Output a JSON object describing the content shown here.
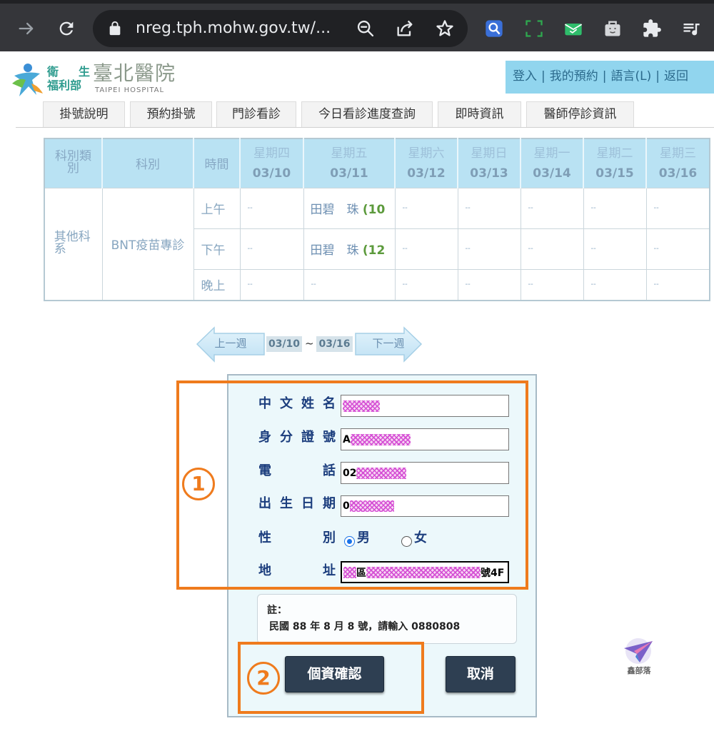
{
  "browser": {
    "url": "nreg.tph.mohw.gov.tw/...",
    "toolbar_icons": [
      "forward-icon",
      "reload-icon",
      "lock-icon",
      "zoom-out-icon",
      "share-icon",
      "star-icon",
      "extension-search-icon",
      "extension-screenshot-icon",
      "extension-mail-icon",
      "extension-bag-icon",
      "extensions-puzzle-icon",
      "media-queue-icon"
    ]
  },
  "header": {
    "logo": {
      "line1": "衛 生",
      "line2": "福利部",
      "name": "臺北醫院",
      "english": "TAIPEI HOSPITAL"
    },
    "links": [
      "登入",
      "我的預約",
      "語言(L)",
      "返回"
    ],
    "separator": "|"
  },
  "tabs": [
    "掛號說明",
    "預約掛號",
    "門診看診",
    "今日看診進度查詢",
    "即時資訊",
    "醫師停診資訊"
  ],
  "schedule": {
    "headers": {
      "category": "科別類別",
      "department": "科別",
      "time": "時間"
    },
    "days": [
      {
        "day": "星期四",
        "date": "03/10"
      },
      {
        "day": "星期五",
        "date": "03/11"
      },
      {
        "day": "星期六",
        "date": "03/12"
      },
      {
        "day": "星期日",
        "date": "03/13"
      },
      {
        "day": "星期一",
        "date": "03/14"
      },
      {
        "day": "星期二",
        "date": "03/15"
      },
      {
        "day": "星期三",
        "date": "03/16"
      }
    ],
    "category": "其他科系",
    "department": "BNT疫苗專診",
    "rows": [
      {
        "time": "上午",
        "cells": [
          "--",
          {
            "doctor": "田碧　珠",
            "count": "(10"
          },
          "--",
          "--",
          "--",
          "--",
          "--"
        ]
      },
      {
        "time": "下午",
        "cells": [
          "--",
          {
            "doctor": "田碧　珠",
            "count": "(12"
          },
          "--",
          "--",
          "--",
          "--",
          "--"
        ]
      },
      {
        "time": "晚上",
        "cells": [
          "--",
          "--",
          "--",
          "--",
          "--",
          "--",
          "--"
        ]
      }
    ]
  },
  "week_nav": {
    "prev": "上一週",
    "start": "03/10",
    "sep": "~",
    "end": "03/16",
    "next": "下一週"
  },
  "form": {
    "labels": {
      "name": "中 文 姓 名",
      "id": "身 分 證 號",
      "phone": "電 話",
      "birth": "出 生 日 期",
      "gender": "性 別",
      "address": "地 址"
    },
    "values": {
      "id_prefix": "A",
      "phone_prefix": "02",
      "birth_prefix": "0",
      "address_mid": "區",
      "address_suffix": "號4F"
    },
    "gender_options": [
      "男",
      "女"
    ],
    "gender_selected": "男",
    "note": {
      "title": "註：",
      "text": "民國 88 年 8 月 8 號，請輸入 0880808"
    },
    "buttons": {
      "confirm": "個資確認",
      "cancel": "取消"
    }
  },
  "annotations": {
    "step1": "1",
    "step2": "2",
    "color": "#ef7b1d"
  },
  "watermark": "鑫部落",
  "colors": {
    "chrome_bg": "#35363a",
    "omnibox_bg": "#202124",
    "link_box": "#91d5ee",
    "table_header": "#b9e2f3",
    "panel_bg": "#ecf8fb",
    "label_text": "#1b3d7d",
    "button_bg": "#2e3f52",
    "count_green": "#5c9a3c"
  }
}
